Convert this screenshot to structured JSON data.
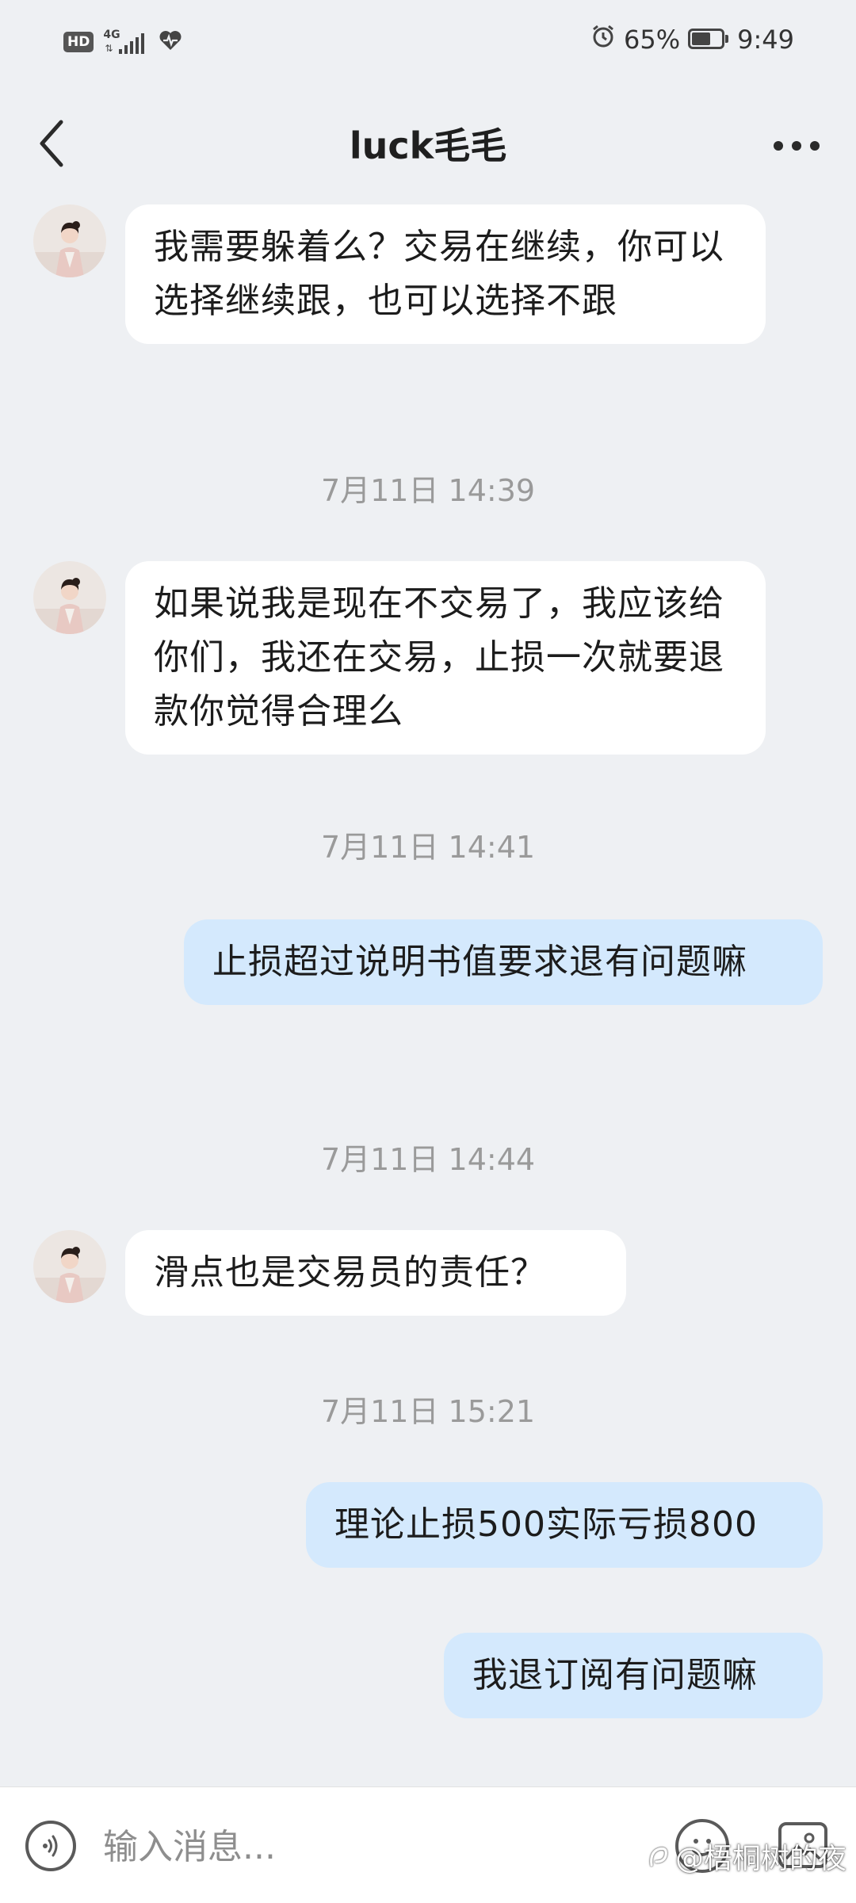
{
  "status_bar": {
    "hd": "HD",
    "network": "4G",
    "battery_text": "65%",
    "battery_level": 0.65,
    "time": "9:49"
  },
  "header": {
    "title": "luck毛毛"
  },
  "messages": [
    {
      "type": "incoming",
      "text": "我需要躲着么？交易在继续，你可以选择继续跟，也可以选择不跟"
    },
    {
      "type": "timestamp",
      "text": "7月11日 14:39"
    },
    {
      "type": "incoming",
      "text": "如果说我是现在不交易了，我应该给你们，我还在交易，止损一次就要退款你觉得合理么"
    },
    {
      "type": "timestamp",
      "text": "7月11日 14:41"
    },
    {
      "type": "outgoing",
      "text": "止损超过说明书值要求退有问题嘛"
    },
    {
      "type": "timestamp",
      "text": "7月11日 14:44"
    },
    {
      "type": "incoming",
      "text": "滑点也是交易员的责任？"
    },
    {
      "type": "timestamp",
      "text": "7月11日 15:21"
    },
    {
      "type": "outgoing",
      "text": "理论止损500实际亏损800"
    },
    {
      "type": "outgoing",
      "text": "我退订阅有问题嘛"
    }
  ],
  "input_bar": {
    "placeholder": "输入消息..."
  },
  "watermark": {
    "text": "@梧桐树的夜"
  },
  "colors": {
    "background": "#eef0f3",
    "incoming_bubble": "#ffffff",
    "outgoing_bubble": "#d4e9fd",
    "timestamp_text": "#9a9a9a"
  }
}
